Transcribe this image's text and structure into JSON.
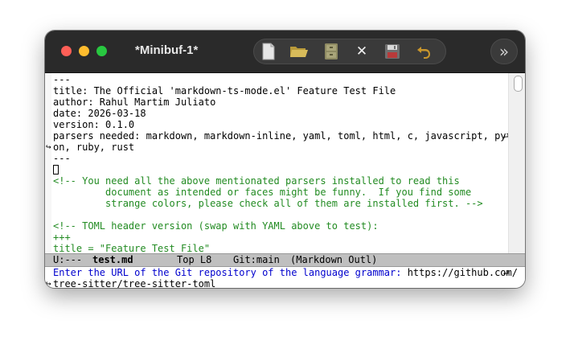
{
  "window": {
    "title": "*Minibuf-1*"
  },
  "toolbar": {
    "icons": [
      "new-file-icon",
      "open-folder-icon",
      "file-cabinet-icon",
      "close-x-icon",
      "save-disk-icon",
      "undo-icon"
    ],
    "close_glyph": "✕"
  },
  "expand_glyph": "»",
  "editor": {
    "lines": [
      {
        "text": "---",
        "face": "plain"
      },
      {
        "text": "title: The Official 'markdown-ts-mode.el' Feature Test File",
        "face": "plain"
      },
      {
        "text": "author: Rahul Martim Juliato",
        "face": "plain"
      },
      {
        "text": "date: 2026-03-18",
        "face": "plain"
      },
      {
        "text": "version: 0.1.0",
        "face": "plain"
      },
      {
        "text": "parsers needed: markdown, markdown-inline, yaml, toml, html, c, javascript, pytho",
        "face": "plain"
      },
      {
        "text": "on, ruby, rust",
        "face": "plain"
      },
      {
        "text": "---",
        "face": "plain"
      },
      {
        "text": "",
        "face": "cursor"
      },
      {
        "text": "<!-- You need all the above mentionated parsers installed to read this",
        "face": "comment"
      },
      {
        "text": "         document as intended or faces might be funny.  If you find some",
        "face": "comment"
      },
      {
        "text": "         strange colors, please check all of them are installed first. -->",
        "face": "comment"
      },
      {
        "text": "",
        "face": "plain"
      },
      {
        "text": "<!-- TOML header version (swap with YAML above to test):",
        "face": "comment"
      },
      {
        "text": "+++",
        "face": "comment"
      },
      {
        "text": "title = \"Feature Test File\"",
        "face": "comment"
      }
    ]
  },
  "modeline": {
    "status": "U:---",
    "buffer": "test.md",
    "position": "Top L8",
    "vc": "Git:main",
    "mode": "(Markdown Outl)"
  },
  "minibuffer": {
    "prompt": "Enter the URL of the Git repository of the language grammar: ",
    "input_line1": "https://github.com/",
    "input_line2": "tree-sitter/tree-sitter-toml"
  }
}
